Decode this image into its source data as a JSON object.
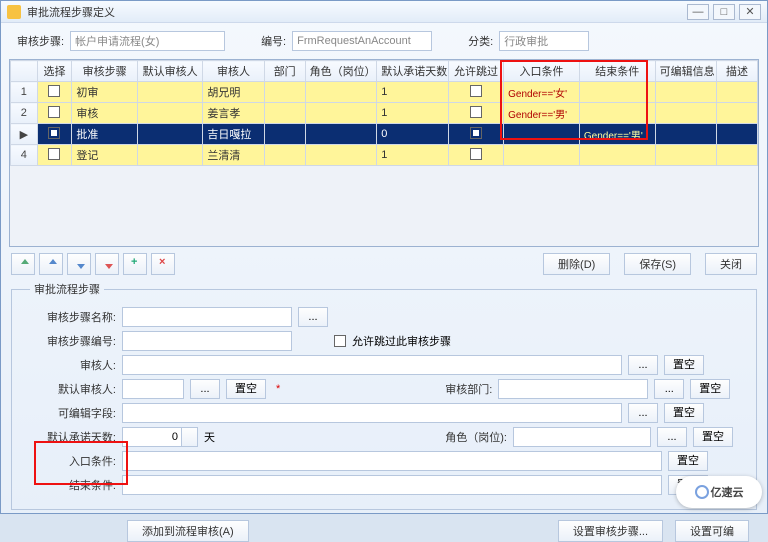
{
  "title": "审批流程步骤定义",
  "filters": {
    "step_label": "审核步骤:",
    "step_value": "帐户申请流程(女)",
    "code_label": "编号:",
    "code_value": "FrmRequestAnAccount",
    "class_label": "分类:",
    "class_value": "行政审批"
  },
  "columns": [
    "",
    "选择",
    "审核步骤",
    "默认审核人",
    "审核人",
    "部门",
    "角色（岗位）",
    "默认承诺天数",
    "允许跳过",
    "入口条件",
    "结束条件",
    "可编辑信息",
    "描述"
  ],
  "rows": [
    {
      "n": "1",
      "step": "初审",
      "reviewer": "胡兄明",
      "days": "1",
      "entry": "Gender=='女'",
      "exit": "",
      "sel": "yellow"
    },
    {
      "n": "2",
      "step": "审核",
      "reviewer": "姜言孝",
      "days": "1",
      "entry": "Gender=='男'",
      "exit": "",
      "sel": "yellow"
    },
    {
      "n": "",
      "step": "批准",
      "reviewer": "吉日嘎拉",
      "days": "0",
      "entry": "",
      "exit": "Gender=='男'",
      "sel": "sel",
      "marker": "▶"
    },
    {
      "n": "4",
      "step": "登记",
      "reviewer": "兰清清",
      "days": "1",
      "entry": "",
      "exit": "",
      "sel": "yellow"
    }
  ],
  "actions": {
    "delete": "删除(D)",
    "save": "保存(S)",
    "close": "关闭"
  },
  "panel": {
    "legend": "审批流程步骤",
    "name_label": "审核步骤名称:",
    "code_label": "审核步骤编号:",
    "skip_label": "允许跳过此审核步骤",
    "reviewer_label": "审核人:",
    "default_reviewer_label": "默认审核人:",
    "dept_label": "审核部门:",
    "editable_label": "可编辑字段:",
    "promise_label": "默认承诺天数:",
    "promise_value": "0",
    "promise_unit": "天",
    "role_label": "角色（岗位):",
    "entry_label": "入口条件:",
    "exit_label": "结束条件:",
    "clear": "置空",
    "ellipsis": "..."
  },
  "bottom": {
    "add": "添加到流程审核(A)",
    "set_step": "设置审核步骤...",
    "set_edit": "设置可编"
  },
  "watermark": "亿速云"
}
